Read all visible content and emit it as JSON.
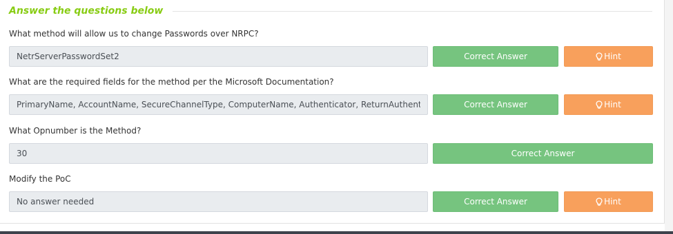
{
  "section": {
    "title": "Answer the questions below"
  },
  "questions": [
    {
      "question": "What method will allow us to change Passwords over NRPC?",
      "answer": "NetrServerPasswordSet2",
      "correct_label": "Correct Answer",
      "hint_label": "Hint"
    },
    {
      "question": "What are the required fields for the method per the Microsoft Documentation?",
      "answer": "PrimaryName, AccountName, SecureChannelType, ComputerName, Authenticator, ReturnAuthenticator, ClearNewPassword",
      "correct_label": "Correct Answer",
      "hint_label": "Hint"
    },
    {
      "question": "What Opnumber is the Method?",
      "answer": "30",
      "correct_label": "Correct Answer"
    },
    {
      "question": "Modify the PoC",
      "answer": "No answer needed",
      "correct_label": "Correct Answer",
      "hint_label": "Hint"
    }
  ],
  "icons": {
    "hint": "lightbulb-icon"
  },
  "colors": {
    "title": "#88cc14",
    "correct_button": "#76c47f",
    "hint_button": "#f8a05c",
    "input_background": "#e9ecef"
  }
}
